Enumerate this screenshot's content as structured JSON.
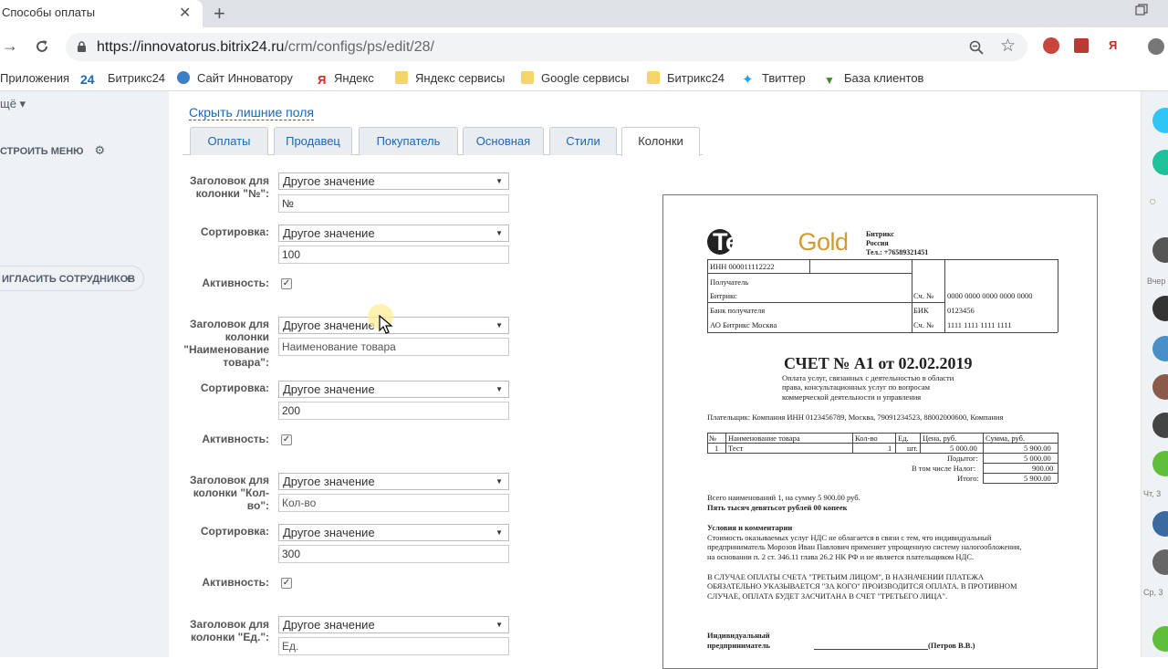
{
  "browser": {
    "tab_title": "Способы оплаты",
    "url_host": "https://innovatorus.bitrix24.ru",
    "url_path": "/crm/configs/ps/edit/28/",
    "bookmarks": [
      "Приложения",
      "Битрикс24",
      "Сайт Инноватору",
      "Яндекс",
      "Яндекс сервисы",
      "Google сервисы",
      "Битрикс24",
      "Твиттер",
      "База клиентов"
    ],
    "ext_yandex": "Я"
  },
  "left_sidebar": {
    "more": "щё",
    "setup_menu": "СТРОИТЬ МЕНЮ",
    "invite": "ИГЛАСИТЬ СОТРУДНИКОВ"
  },
  "right_sidebar": {
    "labels": [
      "Вчер",
      "Чт, 3",
      "Ср, 3"
    ]
  },
  "form": {
    "hide_link": "Скрыть лишние поля",
    "tabs": [
      "Оплаты",
      "Продавец",
      "Покупатель",
      "Основная",
      "Стили",
      "Колонки"
    ],
    "active_tab": "Колонки",
    "fields": [
      {
        "header_label": "Заголовок для колонки \"№\":",
        "select": "Другое значение",
        "input": "№",
        "sort_label": "Сортировка:",
        "sort_select": "Другое значение",
        "sort_input": "100",
        "active_label": "Активность:",
        "checked": true
      },
      {
        "header_label": "Заголовок для колонки \"Наименование товара\":",
        "select": "Другое значение",
        "input": "Наименование товара",
        "sort_label": "Сортировка:",
        "sort_select": "Другое значение",
        "sort_input": "200",
        "active_label": "Активность:",
        "checked": true
      },
      {
        "header_label": "Заголовок для колонки \"Кол-во\":",
        "select": "Другое значение",
        "input": "Кол-во",
        "sort_label": "Сортировка:",
        "sort_select": "Другое значение",
        "sort_input": "300",
        "active_label": "Активность:",
        "checked": true
      },
      {
        "header_label": "Заголовок для колонки \"Ед.\":",
        "select": "Другое значение",
        "input": "Ед."
      }
    ]
  },
  "invoice": {
    "logo_dark": "Tender-",
    "logo_gold": "Gold",
    "company": "Битрикс",
    "country": "Россия",
    "phone": "Тел.: +76589321451",
    "inn": "ИНН 000011112222",
    "recipient": "Получатель",
    "recipient_name": "Битрикс",
    "account_label": "Сч. №",
    "account": "0000 0000 0000 0000 0000",
    "bank_label": "Банк получателя",
    "bank_name": "АО Битрикс Москва",
    "bik_label": "БИК",
    "bik": "0123456",
    "corr_label": "Сч. №",
    "corr": "1111 1111 1111 1111",
    "title": "СЧЕТ № А1 от 02.02.2019",
    "purpose": [
      "Оплата услуг, связанных с деятельностью в области",
      "права, консультационных услуг по вопросам",
      "коммерческой деятельности и управления"
    ],
    "payer": "Плательщик: Компания ИНН 0123456789, Москва, 79091234523, 88002000600, Компания",
    "table_headers": [
      "№",
      "Наименование товара",
      "Кол-во",
      "Ед.",
      "Цена, руб.",
      "Сумма, руб."
    ],
    "table_row": [
      "1",
      "Тест",
      "1",
      "шт.",
      "5 000.00",
      "5 900.00"
    ],
    "totals": [
      {
        "label": "Подытог:",
        "value": "5 000.00"
      },
      {
        "label": "В том числе Налог:",
        "value": "900.00"
      },
      {
        "label": "Итого:",
        "value": "5 900.00"
      }
    ],
    "summary": "Всего наименований 1, на сумму 5 900.00 руб.",
    "summary_words": "Пять тысяч девятьсот рублей 00 копеек",
    "conditions_title": "Условия и комментарии",
    "conditions": [
      "Стоимость оказываемых услуг НДС не облагается в связи с тем, что индивидуальный",
      "предприниматель Морозов Иван Павлович применяет упрощенную систему налогообложения,",
      "на основании п. 2 ст. 346.11 глава 26.2 НК РФ и не является плательщиком НДС."
    ],
    "warning": [
      "В СЛУЧАЕ ОПЛАТЫ СЧЕТА \"ТРЕТЬИМ ЛИЦОМ\", В НАЗНАЧЕНИИ ПЛАТЕЖА",
      "ОБЯЗАТЕЛЬНО УКАЗЫВАЕТСЯ \"ЗА КОГО\" ПРОИЗВОДИТСЯ ОПЛАТА. В ПРОТИВНОМ",
      "СЛУЧАЕ, ОПЛАТА БУДЕТ ЗАСЧИТАНА В СЧЕТ \"ТРЕТЬЕГО ЛИЦА\"."
    ],
    "signer_1": "Индивидуальный",
    "signer_2": "предприниматель",
    "signer_name": "(Петров В.В.)"
  },
  "colors": {
    "link": "#2067b0",
    "logo_gold": "#d29b2f",
    "sidebar_bg": "#eef2f4"
  }
}
